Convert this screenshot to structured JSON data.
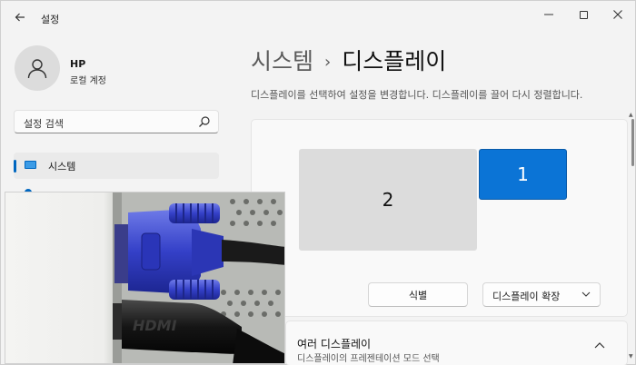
{
  "window": {
    "title": "설정",
    "controls": {
      "minimize": "—"
    }
  },
  "profile": {
    "name": "HP",
    "account_type": "로컬 계정"
  },
  "search": {
    "placeholder": "설정 검색"
  },
  "sidebar": {
    "items": [
      {
        "label": "시스템",
        "selected": true
      }
    ]
  },
  "main": {
    "breadcrumb": {
      "parent": "시스템",
      "separator": "›",
      "current": "디스플레이"
    },
    "description": "디스플레이를 선택하여 설정을 변경합니다. 디스플레이를 끌어 다시 정렬합니다.",
    "monitors": [
      {
        "number": "2"
      },
      {
        "number": "1",
        "selected": true
      }
    ],
    "identify_label": "식별",
    "mode_select": {
      "value": "디스플레이 확장"
    },
    "multi_display": {
      "title": "여러 디스플레이",
      "subtitle": "디스플레이의 프레젠테이션 모드 선택"
    }
  },
  "colors": {
    "accent": "#0067c0",
    "selected_monitor": "#0b74d6",
    "background": "#f3f3f3"
  },
  "icons": [
    "back-arrow-icon",
    "minimize-icon",
    "maximize-icon",
    "close-icon",
    "user-icon",
    "search-icon",
    "display-icon",
    "chevron-down-icon",
    "chevron-up-icon"
  ]
}
